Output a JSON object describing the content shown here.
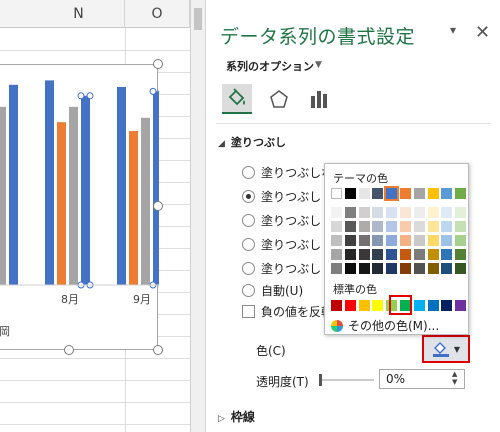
{
  "sheet": {
    "columns": [
      "N",
      "O"
    ],
    "xticks": [
      "8月",
      "9月"
    ],
    "legend_fragment": "岡"
  },
  "chart_data": {
    "type": "bar",
    "categories": [
      "",
      "8月",
      "9月"
    ],
    "series": [
      {
        "color": "#4472c4",
        "values": [
          84,
          93,
          90
        ]
      },
      {
        "color": "#ed7d31",
        "values": [
          76,
          74,
          70
        ]
      },
      {
        "color": "#a5a5a5",
        "values": [
          81,
          81,
          76
        ]
      },
      {
        "color": "#4472c4",
        "values": [
          91,
          86,
          88
        ]
      }
    ],
    "ylim": [
      0,
      100
    ]
  },
  "pane": {
    "title": "データ系列の書式設定",
    "series_options": "系列のオプション",
    "fill_section": "塗りつぶし",
    "radio_options": [
      "塗りつぶしなし",
      "塗りつぶし (単",
      "塗りつぶし (グ",
      "塗りつぶし (図",
      "塗りつぶし (パ",
      "自動(U)"
    ],
    "invert_label": "負の値を反転",
    "color_label": "色(C)",
    "transparency_label": "透明度(T)",
    "transparency_value": "0%",
    "border_section": "枠線"
  },
  "palette": {
    "theme_label": "テーマの色",
    "standard_label": "標準の色",
    "more_colors": "その他の色(M)...",
    "theme_top": [
      "#ffffff",
      "#000000",
      "#e7e6e6",
      "#44546a",
      "#4472c4",
      "#ed7d31",
      "#a5a5a5",
      "#ffc000",
      "#5b9bd5",
      "#70ad47"
    ],
    "theme_shades": [
      [
        "#f2f2f2",
        "#7f7f7f",
        "#d0cece",
        "#d6dce4",
        "#d9e2f3",
        "#fbe5d5",
        "#ededed",
        "#fff2cc",
        "#deeaf6",
        "#e2efd9"
      ],
      [
        "#d8d8d8",
        "#595959",
        "#aeabab",
        "#adb9ca",
        "#b4c6e7",
        "#f7cbac",
        "#dbdbdb",
        "#fee599",
        "#bdd7ee",
        "#c5e0b3"
      ],
      [
        "#bfbfbf",
        "#3f3f3f",
        "#757070",
        "#8496b0",
        "#8eaadb",
        "#f4b183",
        "#c9c9c9",
        "#ffd965",
        "#9cc3e5",
        "#a8d08d"
      ],
      [
        "#a5a5a5",
        "#262626",
        "#3a3838",
        "#323f4f",
        "#2f5496",
        "#c45911",
        "#7b7b7b",
        "#bf9000",
        "#2e75b5",
        "#538135"
      ],
      [
        "#7f7f7f",
        "#0c0c0c",
        "#171616",
        "#222a35",
        "#1f3864",
        "#833c0b",
        "#525252",
        "#7f6000",
        "#1e4e79",
        "#375623"
      ]
    ],
    "standard": [
      "#c00000",
      "#ff0000",
      "#ffc000",
      "#ffff00",
      "#92d050",
      "#00b050",
      "#00b0f0",
      "#0070c0",
      "#002060",
      "#7030a0"
    ]
  }
}
